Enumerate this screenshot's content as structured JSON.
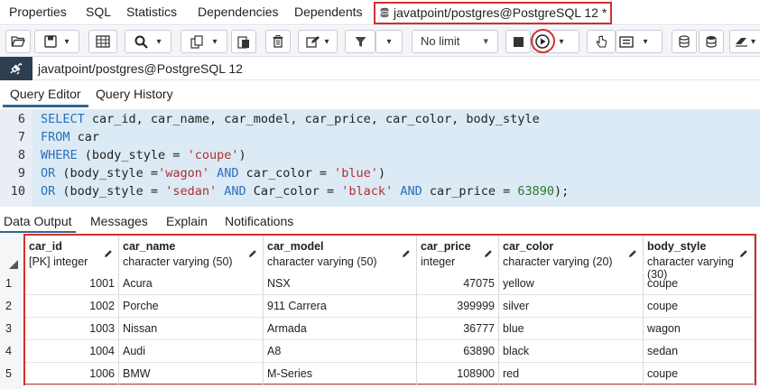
{
  "top_tabs": {
    "properties": "Properties",
    "sql": "SQL",
    "statistics": "Statistics",
    "dependencies": "Dependencies",
    "dependents": "Dependents",
    "query_tab": "javatpoint/postgres@PostgreSQL 12 *"
  },
  "toolbar": {
    "limit_select": "No limit"
  },
  "connection": {
    "label": "javatpoint/postgres@PostgreSQL 12"
  },
  "editor_tabs": {
    "query_editor": "Query Editor",
    "query_history": "Query History"
  },
  "code_lines": [
    {
      "num": "6",
      "parts": [
        [
          "kw",
          "SELECT"
        ],
        [
          "t",
          " car_id, car_name, car_model, car_price, car_color, body_style"
        ]
      ]
    },
    {
      "num": "7",
      "parts": [
        [
          "kw",
          "FROM"
        ],
        [
          "t",
          " car"
        ]
      ]
    },
    {
      "num": "8",
      "parts": [
        [
          "kw",
          "WHERE"
        ],
        [
          "t",
          " (body_style = "
        ],
        [
          "str",
          "'coupe'"
        ],
        [
          "t",
          ")"
        ]
      ]
    },
    {
      "num": "9",
      "parts": [
        [
          "kw",
          "OR"
        ],
        [
          "t",
          " (body_style ="
        ],
        [
          "str",
          "'wagon'"
        ],
        [
          "t",
          " "
        ],
        [
          "kw",
          "AND"
        ],
        [
          "t",
          " car_color = "
        ],
        [
          "str",
          "'blue'"
        ],
        [
          "t",
          ")"
        ]
      ]
    },
    {
      "num": "10",
      "parts": [
        [
          "kw",
          "OR"
        ],
        [
          "t",
          " (body_style = "
        ],
        [
          "str",
          "'sedan'"
        ],
        [
          "t",
          " "
        ],
        [
          "kw",
          "AND"
        ],
        [
          "t",
          " Car_color = "
        ],
        [
          "str",
          "'black'"
        ],
        [
          "t",
          " "
        ],
        [
          "kw",
          "AND"
        ],
        [
          "t",
          " car_price = "
        ],
        [
          "num",
          "63890"
        ],
        [
          "t",
          ");"
        ]
      ]
    }
  ],
  "output_tabs": {
    "data_output": "Data Output",
    "messages": "Messages",
    "explain": "Explain",
    "notifications": "Notifications"
  },
  "grid": {
    "columns": [
      {
        "name": "car_id",
        "type": "[PK] integer",
        "align": "right"
      },
      {
        "name": "car_name",
        "type": "character varying (50)",
        "align": "left"
      },
      {
        "name": "car_model",
        "type": "character varying (50)",
        "align": "left"
      },
      {
        "name": "car_price",
        "type": "integer",
        "align": "right"
      },
      {
        "name": "car_color",
        "type": "character varying (20)",
        "align": "left"
      },
      {
        "name": "body_style",
        "type": "character varying (30)",
        "align": "left"
      }
    ],
    "rows": [
      {
        "n": "1",
        "cells": [
          "1001",
          "Acura",
          "NSX",
          "47075",
          "yellow",
          "coupe"
        ]
      },
      {
        "n": "2",
        "cells": [
          "1002",
          "Porche",
          "911 Carrera",
          "399999",
          "silver",
          "coupe"
        ]
      },
      {
        "n": "3",
        "cells": [
          "1003",
          "Nissan",
          "Armada",
          "36777",
          "blue",
          "wagon"
        ]
      },
      {
        "n": "4",
        "cells": [
          "1004",
          "Audi",
          "A8",
          "63890",
          "black",
          "sedan"
        ]
      },
      {
        "n": "5",
        "cells": [
          "1006",
          "BMW",
          "M-Series",
          "108900",
          "red",
          "coupe"
        ]
      }
    ]
  },
  "colors": {
    "highlight": "#d32f2f",
    "keyword": "#2a6fbb",
    "string": "#b03030",
    "editor_bg": "#dceaf5",
    "conn_bar": "#2c3e50"
  }
}
